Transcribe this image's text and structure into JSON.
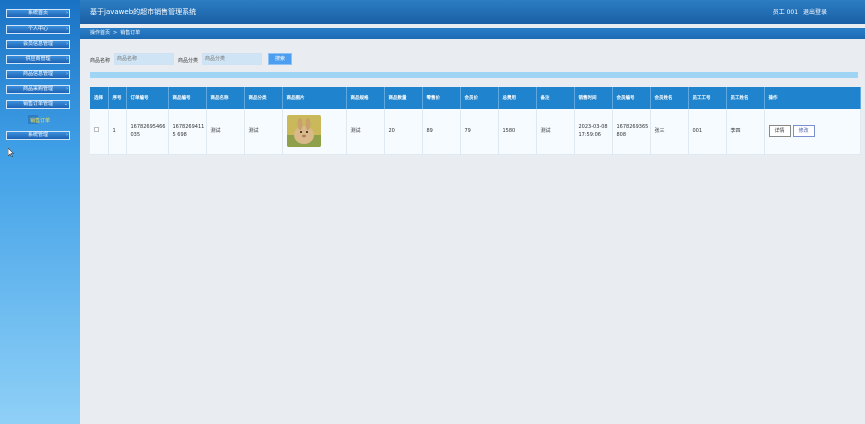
{
  "header": {
    "title": "基于javaweb的超市销售管理系统",
    "user_label": "员工 001",
    "logout_label": "退出登录"
  },
  "sidebar": {
    "items": [
      {
        "label": "系统首页"
      },
      {
        "label": "个人中心"
      },
      {
        "label": "会员信息管理"
      },
      {
        "label": "供应商管理"
      },
      {
        "label": "商品信息管理"
      },
      {
        "label": "商品采购管理"
      },
      {
        "label": "销售订单管理"
      },
      {
        "label": "系统管理"
      }
    ],
    "active_sub": "销售订单"
  },
  "breadcrumb": {
    "home": "操作首页",
    "current": "销售订单"
  },
  "search": {
    "name_label": "商品名称",
    "name_placeholder": "商品名称",
    "category_label": "商品分类",
    "category_placeholder": "商品分类",
    "button_label": "搜索"
  },
  "table": {
    "headers": [
      "选择",
      "序号",
      "订单编号",
      "商品编号",
      "商品名称",
      "商品分类",
      "商品图片",
      "商品规格",
      "商品数量",
      "零售价",
      "会员价",
      "总费用",
      "备注",
      "销售时间",
      "会员编号",
      "会员姓名",
      "员工工号",
      "员工姓名",
      "操作"
    ],
    "rows": [
      {
        "index": "1",
        "order_no": "16782695466035",
        "product_no": "16782694115 698",
        "product_name": "测试",
        "category": "测试",
        "spec": "测试",
        "quantity": "20",
        "retail_price": "89",
        "member_price": "79",
        "total": "1580",
        "remark": "测试",
        "sale_time": "2023-03-08 17:59:06",
        "member_no": "1678269365 808",
        "member_name": "张三",
        "staff_no": "001",
        "staff_name": "李四",
        "detail_label": "详情",
        "edit_label": "修改"
      }
    ]
  },
  "colors": {
    "header_bg": "#1f6bb5",
    "table_head": "#1f83cd",
    "search_button": "#4c9ff0",
    "active_sub_text": "#ffe34a"
  }
}
